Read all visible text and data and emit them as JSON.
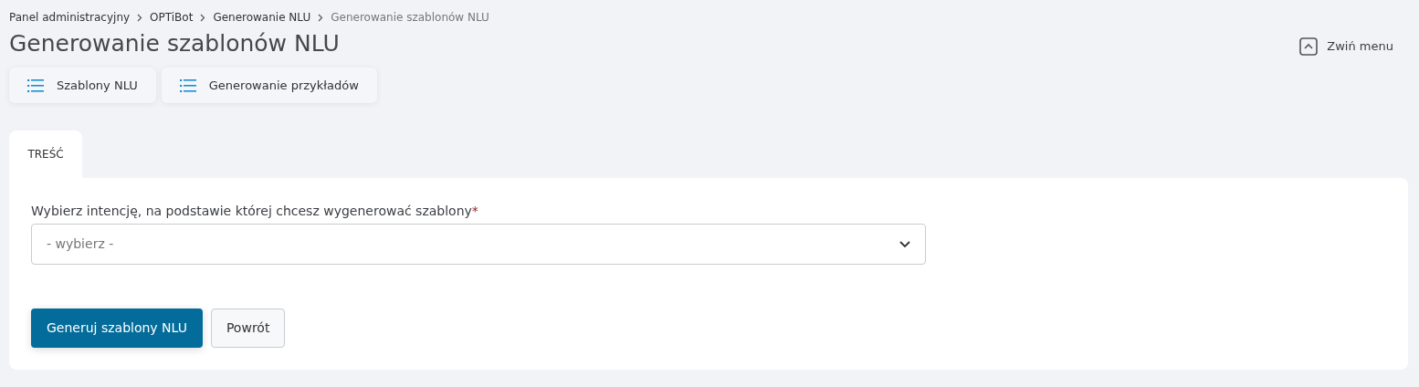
{
  "breadcrumb": [
    {
      "label": "Panel administracyjny",
      "current": false
    },
    {
      "label": "OPTiBot",
      "current": false
    },
    {
      "label": "Generowanie NLU",
      "current": false
    },
    {
      "label": "Generowanie szablonów NLU",
      "current": true
    }
  ],
  "title": "Generowanie szablonów NLU",
  "collapse_menu": {
    "label": "Zwiń menu"
  },
  "nav_buttons": [
    {
      "label": "Szablony NLU"
    },
    {
      "label": "Generowanie przykładów"
    }
  ],
  "tabs": [
    {
      "label": "TREŚĆ",
      "selected": true
    }
  ],
  "form": {
    "label": "Wybierz intencję, na podstawie której chcesz wygenerować szablony",
    "required_mark": "*",
    "placeholder": "- wybierz -"
  },
  "buttons": [
    {
      "label": "Generuj szablony NLU",
      "kind": "primary"
    },
    {
      "label": "Powrót",
      "kind": "secondary"
    }
  ]
}
